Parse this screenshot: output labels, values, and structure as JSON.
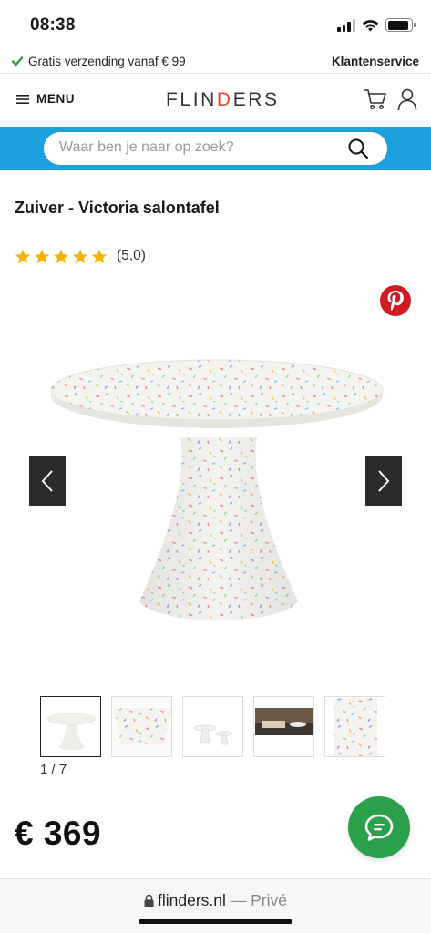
{
  "status_bar": {
    "time": "08:38",
    "battery_level": 0.9
  },
  "shipping_bar": {
    "message": "Gratis verzending vanaf € 99",
    "customer_service": "Klantenservice"
  },
  "header": {
    "menu_label": "MENU",
    "logo_prefix": "FLIN",
    "logo_highlight": "D",
    "logo_suffix": "ERS"
  },
  "search": {
    "placeholder": "Waar ben je naar op zoek?"
  },
  "product": {
    "title": "Zuiver - Victoria salontafel",
    "rating_stars": 5,
    "rating_text": "(5,0)",
    "price": "€ 369"
  },
  "gallery": {
    "counter": "1 / 7",
    "thumbnail_count_visible": 5,
    "active_index": 0
  },
  "browser": {
    "domain": "flinders.nl",
    "mode": " — Privé"
  },
  "colors": {
    "accent_blue": "#1ea0dc",
    "star_yellow": "#f5b301",
    "pinterest_red": "#d11a26",
    "chat_green": "#2aa14a",
    "ship_check_green": "#2a9a3e"
  },
  "icons": {
    "ship_check": "check-icon",
    "menu": "hamburger-icon",
    "cart": "cart-icon",
    "user": "user-icon",
    "search": "search-icon",
    "pinterest": "pinterest-icon",
    "prev": "chevron-left-icon",
    "next": "chevron-right-icon",
    "chat": "chat-icon",
    "lock": "lock-icon"
  }
}
